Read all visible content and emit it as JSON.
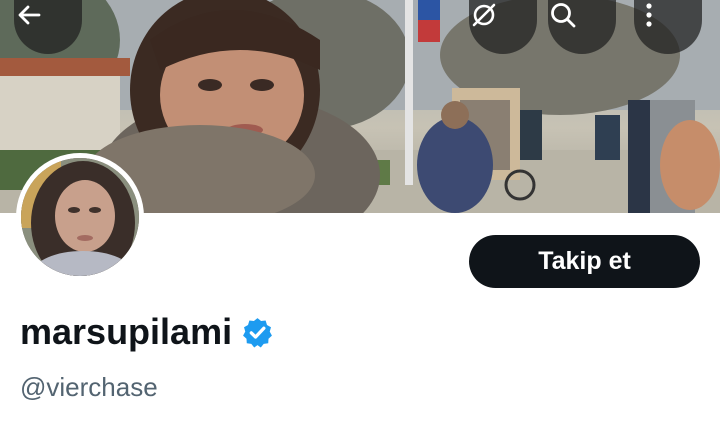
{
  "header": {
    "buttons": [
      {
        "name": "back-arrow-icon"
      },
      {
        "name": "hide-icon"
      },
      {
        "name": "search-icon"
      },
      {
        "name": "more-vertical-icon"
      }
    ]
  },
  "profile": {
    "display_name": "marsupilami",
    "verified": true,
    "handle": "@vierchase",
    "follow_label": "Takip et"
  },
  "colors": {
    "follow_bg": "#0f1419",
    "verified_blue": "#1d9bf0",
    "handle_gray": "#536471"
  }
}
